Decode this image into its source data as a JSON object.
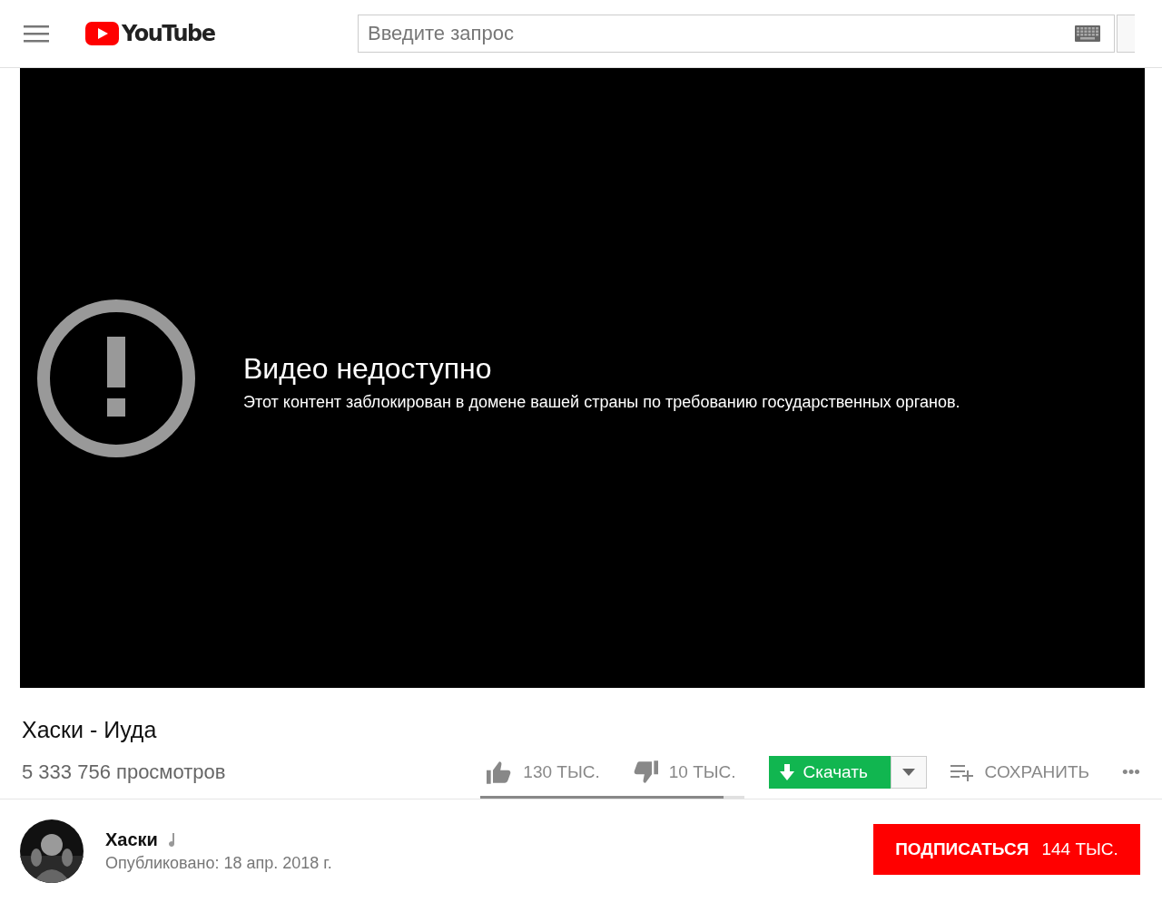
{
  "header": {
    "logo_text": "YouTube",
    "search": {
      "placeholder": "Введите запрос"
    }
  },
  "player": {
    "error_title": "Видео недоступно",
    "error_message": "Этот контент заблокирован в домене вашей страны по требованию государственных органов."
  },
  "video": {
    "title": "Хаски - Иуда",
    "views": "5 333 756 просмотров",
    "likes": "130 ТЫС.",
    "dislikes": "10 ТЫС.",
    "sentiment": {
      "level": 0.92
    },
    "download_button": "Скачать",
    "save_button": "СОХРАНИТЬ",
    "more_button": "•••"
  },
  "channel": {
    "name": "Хаски",
    "music_badge": true,
    "published": "Опубликовано: 18 апр. 2018 г.",
    "subscribe_button": "ПОДПИСАТЬСЯ",
    "subscribers": "144 ТЫС."
  }
}
